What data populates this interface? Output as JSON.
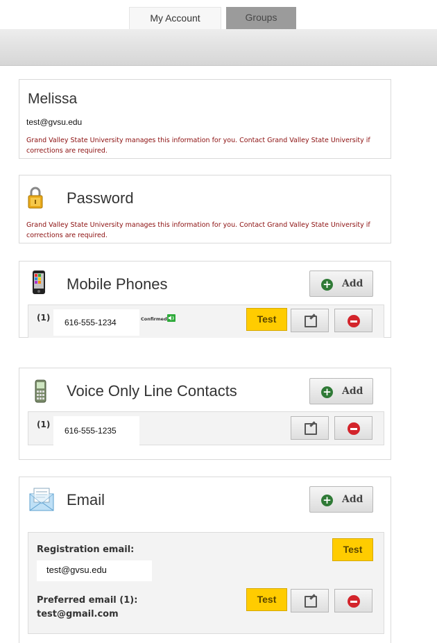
{
  "tabs": {
    "my_account": "My Account",
    "groups": "Groups"
  },
  "profile": {
    "name": "Melissa",
    "email": "test@gvsu.edu",
    "note": "Grand Valley State University manages this information for you. Contact Grand Valley State University if corrections are required."
  },
  "password": {
    "title": "Password",
    "note": "Grand Valley State University manages this information for you. Contact Grand Valley State University if corrections are required."
  },
  "mobile": {
    "title": "Mobile Phones",
    "add_label": "Add",
    "index": "(1)",
    "number": "616-555-1234",
    "status": "Confirmed",
    "test_label": "Test"
  },
  "voice": {
    "title": "Voice Only Line Contacts",
    "add_label": "Add",
    "index": "(1)",
    "number": "616-555-1235"
  },
  "email": {
    "title": "Email",
    "add_label": "Add",
    "registration_label": "Registration email:",
    "registration_value": "test@gvsu.edu",
    "registration_test": "Test",
    "preferred_label": "Preferred email (1):",
    "preferred_value": "test@gmail.com",
    "preferred_test": "Test"
  },
  "colors": {
    "accent_test": "#ffcc00",
    "note_red": "#8b0e0e",
    "add_plus": "#2f7a36",
    "remove_red": "#d3242b"
  }
}
